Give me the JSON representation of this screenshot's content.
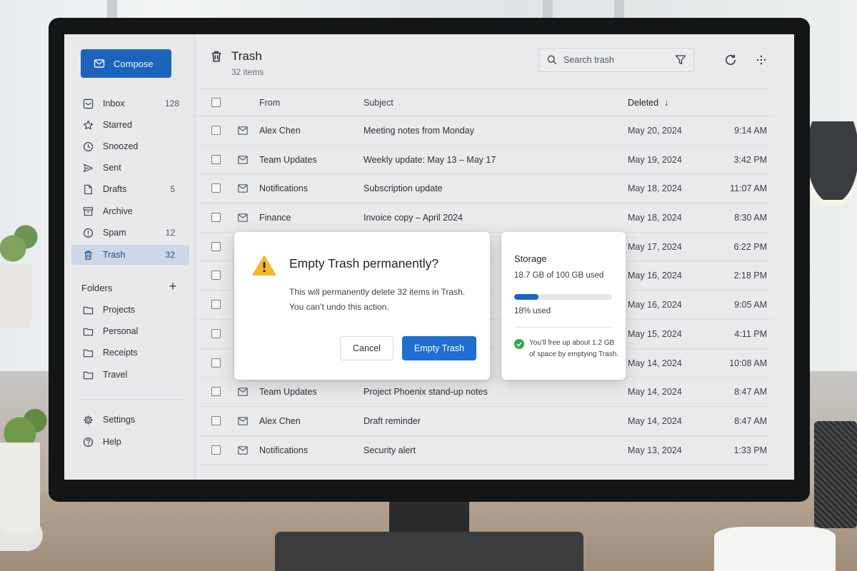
{
  "sidebar": {
    "compose_label": "Compose",
    "items": [
      {
        "label": "Inbox",
        "count": "128",
        "icon": "inbox-icon"
      },
      {
        "label": "Starred",
        "count": "",
        "icon": "star-icon"
      },
      {
        "label": "Snoozed",
        "count": "",
        "icon": "clock-icon"
      },
      {
        "label": "Sent",
        "count": "",
        "icon": "send-icon"
      },
      {
        "label": "Drafts",
        "count": "5",
        "icon": "draft-icon"
      },
      {
        "label": "Archive",
        "count": "",
        "icon": "archive-icon"
      },
      {
        "label": "Spam",
        "count": "12",
        "icon": "spam-icon"
      },
      {
        "label": "Trash",
        "count": "32",
        "icon": "trash-icon"
      }
    ],
    "folders_heading": "Folders",
    "folders_add": "+",
    "folders": [
      "Projects",
      "Personal",
      "Receipts",
      "Travel"
    ],
    "settings_label": "Settings",
    "help_label": "Help"
  },
  "header": {
    "title": "Trash",
    "subtitle": "32 items",
    "search_placeholder": "Search trash"
  },
  "table": {
    "columns": {
      "from": "From",
      "subject": "Subject",
      "deleted": "Deleted",
      "sort_arrow": "↓"
    },
    "rows": [
      {
        "from": "Alex Chen",
        "subject": "Meeting notes from Monday",
        "date": "May 20, 2024",
        "time": "9:14 AM"
      },
      {
        "from": "Team Updates",
        "subject": "Weekly update: May 13 – May 17",
        "date": "May 19, 2024",
        "time": "3:42 PM"
      },
      {
        "from": "Notifications",
        "subject": "Subscription update",
        "date": "May 18, 2024",
        "time": "11:07 AM"
      },
      {
        "from": "Finance",
        "subject": "Invoice copy – April 2024",
        "date": "May 18, 2024",
        "time": "8:30 AM"
      },
      {
        "from": "",
        "subject": "",
        "date": "May 17, 2024",
        "time": "6:22 PM"
      },
      {
        "from": "",
        "subject": "",
        "date": "May 16, 2024",
        "time": "2:18 PM"
      },
      {
        "from": "",
        "subject": "",
        "date": "May 16, 2024",
        "time": "9:05 AM"
      },
      {
        "from": "",
        "subject": "",
        "date": "May 15, 2024",
        "time": "4:11 PM"
      },
      {
        "from": "",
        "subject": "",
        "date": "May 14, 2024",
        "time": "10:08 AM"
      },
      {
        "from": "Team Updates",
        "subject": "Project Phoenix stand-up notes",
        "date": "May 14, 2024",
        "time": "8:47 AM"
      },
      {
        "from": "Alex Chen",
        "subject": "Draft reminder",
        "date": "May 14, 2024",
        "time": "8:47 AM"
      },
      {
        "from": "Notifications",
        "subject": "Security alert",
        "date": "May 13, 2024",
        "time": "1:33 PM"
      }
    ]
  },
  "dialog": {
    "title": "Empty Trash permanently?",
    "line1": "This will permanently delete 32 items in Trash.",
    "line2": "You can’t undo this action.",
    "cancel_label": "Cancel",
    "confirm_label": "Empty Trash"
  },
  "storage": {
    "title": "Storage",
    "used_text": "18.7 GB of 100 GB used",
    "used_fraction": 0.25,
    "percent_text": "18% used",
    "note": "You’ll free up about 1.2 GB of space by emptying Trash."
  },
  "colors": {
    "accent": "#1a66c3",
    "active_nav_bg": "#d5e2f3",
    "success": "#34a853",
    "warning": "#f5b82e"
  }
}
